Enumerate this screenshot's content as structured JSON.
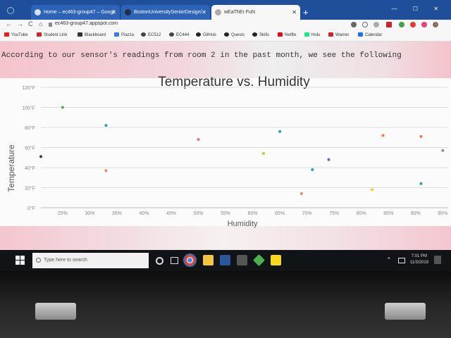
{
  "browser": {
    "tabs": [
      {
        "label": "Home – ec463-group47 – Googl",
        "active": false
      },
      {
        "label": "BostonUniversitySeniorDesign/",
        "active": false
      },
      {
        "label": "wEaThEr FuN",
        "active": true
      }
    ],
    "new_tab_label": "+",
    "nav": {
      "back": "←",
      "forward": "→",
      "reload": "C",
      "home": "⌂"
    },
    "url": "ec463-group47.appspot.com",
    "bookmarks": [
      {
        "label": "YouTube",
        "color": "#e62117"
      },
      {
        "label": "Student Link",
        "color": "#c62828"
      },
      {
        "label": "Blackboard",
        "color": "#333333"
      },
      {
        "label": "Piazza",
        "color": "#3b7dd8"
      },
      {
        "label": "EC512",
        "color": "#444444"
      },
      {
        "label": "EC444",
        "color": "#444444"
      },
      {
        "label": "GitHub",
        "color": "#222222"
      },
      {
        "label": "Quests",
        "color": "#222222"
      },
      {
        "label": "Skills",
        "color": "#222222"
      },
      {
        "label": "Netflix",
        "color": "#e50914"
      },
      {
        "label": "Hulu",
        "color": "#1ce783"
      },
      {
        "label": "Warren",
        "color": "#c62828"
      },
      {
        "label": "Calendar",
        "color": "#1a73e8"
      }
    ]
  },
  "page": {
    "intro_text": "According to our sensor's readings from room 2 in the past month, we see the following"
  },
  "chart_data": {
    "type": "scatter",
    "title": "Temperature vs. Humidity",
    "xlabel": "Humidity",
    "ylabel": "Temperature",
    "x_ticks": [
      "25%",
      "30%",
      "35%",
      "40%",
      "45%",
      "50%",
      "55%",
      "60%",
      "65%",
      "70%",
      "75%",
      "80%",
      "85%",
      "90%",
      "95%"
    ],
    "y_ticks": [
      "0°F",
      "20°F",
      "40°F",
      "60°F",
      "80°F",
      "100°F",
      "120°F"
    ],
    "xlim": [
      21,
      96
    ],
    "ylim": [
      0,
      120
    ],
    "grid": true,
    "points": [
      {
        "x": 21,
        "y": 51,
        "color": "#3a3a3a"
      },
      {
        "x": 25,
        "y": 100,
        "color": "#4caf50"
      },
      {
        "x": 33,
        "y": 82,
        "color": "#26a69a"
      },
      {
        "x": 33,
        "y": 37,
        "color": "#ef8a5a"
      },
      {
        "x": 50,
        "y": 68,
        "color": "#e57373"
      },
      {
        "x": 62,
        "y": 54,
        "color": "#c0ca33"
      },
      {
        "x": 65,
        "y": 76,
        "color": "#26a69a"
      },
      {
        "x": 69,
        "y": 14,
        "color": "#ef8a5a"
      },
      {
        "x": 71,
        "y": 38,
        "color": "#26a69a"
      },
      {
        "x": 74,
        "y": 48,
        "color": "#5c6bc0"
      },
      {
        "x": 82,
        "y": 18,
        "color": "#ffca28"
      },
      {
        "x": 84,
        "y": 72,
        "color": "#ff7043"
      },
      {
        "x": 91,
        "y": 24,
        "color": "#26a69a"
      },
      {
        "x": 91,
        "y": 71,
        "color": "#ff7043"
      },
      {
        "x": 95,
        "y": 57,
        "color": "#a1887f"
      }
    ]
  },
  "taskbar": {
    "search_placeholder": "Type here to search",
    "time": "7:01 PM",
    "date": "11/3/2019",
    "icons": [
      "task-view",
      "chrome",
      "file-explorer",
      "word",
      "store",
      "app-green",
      "app-yellow"
    ]
  }
}
